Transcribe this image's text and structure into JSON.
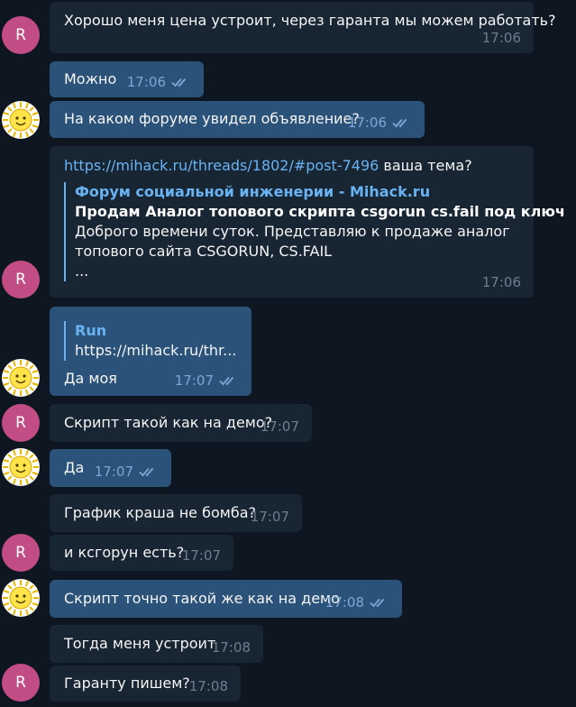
{
  "messages": [
    {
      "text": "Хорошо меня цена устроит, через гаранта мы можем работать?",
      "time": "17:06"
    },
    {
      "text": "Можно",
      "time": "17:06"
    },
    {
      "text": "На каком форуме увидел объявление?",
      "time": "17:06"
    },
    {
      "link": "https://mihack.ru/threads/1802/#post-7496",
      "text_after_link": " ваша тема?",
      "preview": {
        "site": "Форум социальной инженерии - Mihack.ru",
        "title": "Продам Аналог топового скрипта csgorun cs.fail под ключ",
        "line1": "Доброго времени суток. Представляю к продаже аналог",
        "line2": "топового сайта CSGORUN, CS.FAIL",
        "line3": "..."
      },
      "time": "17:06"
    },
    {
      "reply": {
        "name": "Run",
        "text": "https://mihack.ru/thr..."
      },
      "text": "Да моя",
      "time": "17:07"
    },
    {
      "text": "Скрипт такой как на демо?",
      "time": "17:07"
    },
    {
      "text": "Да",
      "time": "17:07"
    },
    {
      "text": "График краша не бомба?",
      "time": "17:07"
    },
    {
      "text": "и ксгорун есть?",
      "time": "17:07"
    },
    {
      "text": "Скрипт точно такой же как на демо",
      "time": "17:08"
    },
    {
      "text": "Тогда меня устроит",
      "time": "17:08"
    },
    {
      "text": "Гаранту пишем?",
      "time": "17:08"
    }
  ],
  "avatar_initial": "R",
  "colors": {
    "background": "#0e1621",
    "incoming_bubble": "#182533",
    "outgoing_bubble": "#2b5278",
    "link": "#6ab3f3",
    "avatar_r": "#c14d84",
    "read_ticks": "#7da8d3"
  },
  "icons": {
    "read_status": "double-check-icon",
    "user_avatar": "sun-smiley-avatar"
  }
}
